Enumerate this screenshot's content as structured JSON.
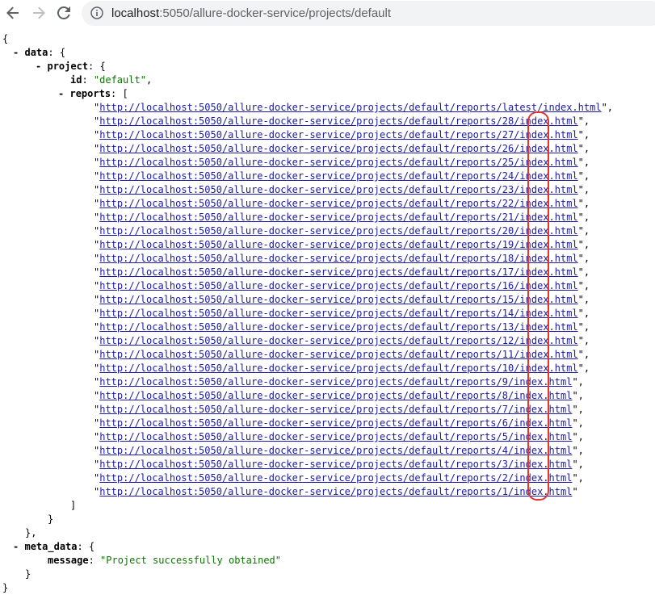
{
  "browser": {
    "url_host": "localhost",
    "url_rest": ":5050/allure-docker-service/projects/default",
    "icons": {
      "back": "arrow-left-icon",
      "forward": "arrow-right-icon",
      "reload": "reload-icon",
      "info": "info-icon"
    }
  },
  "json_view": {
    "open_brace": "{",
    "close_brace": "}",
    "collapse_symbol": "-",
    "data_key": "data",
    "project_key": "project",
    "id_key": "id",
    "id_value": "\"default\"",
    "reports_key": "reports",
    "open_bracket": "[",
    "close_bracket": "]",
    "meta_key": "meta_data",
    "message_key": "message",
    "message_value": "\"Project successfully obtained\"",
    "reports": [
      "http://localhost:5050/allure-docker-service/projects/default/reports/latest/index.html",
      "http://localhost:5050/allure-docker-service/projects/default/reports/28/index.html",
      "http://localhost:5050/allure-docker-service/projects/default/reports/27/index.html",
      "http://localhost:5050/allure-docker-service/projects/default/reports/26/index.html",
      "http://localhost:5050/allure-docker-service/projects/default/reports/25/index.html",
      "http://localhost:5050/allure-docker-service/projects/default/reports/24/index.html",
      "http://localhost:5050/allure-docker-service/projects/default/reports/23/index.html",
      "http://localhost:5050/allure-docker-service/projects/default/reports/22/index.html",
      "http://localhost:5050/allure-docker-service/projects/default/reports/21/index.html",
      "http://localhost:5050/allure-docker-service/projects/default/reports/20/index.html",
      "http://localhost:5050/allure-docker-service/projects/default/reports/19/index.html",
      "http://localhost:5050/allure-docker-service/projects/default/reports/18/index.html",
      "http://localhost:5050/allure-docker-service/projects/default/reports/17/index.html",
      "http://localhost:5050/allure-docker-service/projects/default/reports/16/index.html",
      "http://localhost:5050/allure-docker-service/projects/default/reports/15/index.html",
      "http://localhost:5050/allure-docker-service/projects/default/reports/14/index.html",
      "http://localhost:5050/allure-docker-service/projects/default/reports/13/index.html",
      "http://localhost:5050/allure-docker-service/projects/default/reports/12/index.html",
      "http://localhost:5050/allure-docker-service/projects/default/reports/11/index.html",
      "http://localhost:5050/allure-docker-service/projects/default/reports/10/index.html",
      "http://localhost:5050/allure-docker-service/projects/default/reports/9/index.html",
      "http://localhost:5050/allure-docker-service/projects/default/reports/8/index.html",
      "http://localhost:5050/allure-docker-service/projects/default/reports/7/index.html",
      "http://localhost:5050/allure-docker-service/projects/default/reports/6/index.html",
      "http://localhost:5050/allure-docker-service/projects/default/reports/5/index.html",
      "http://localhost:5050/allure-docker-service/projects/default/reports/4/index.html",
      "http://localhost:5050/allure-docker-service/projects/default/reports/3/index.html",
      "http://localhost:5050/allure-docker-service/projects/default/reports/2/index.html",
      "http://localhost:5050/allure-docker-service/projects/default/reports/1/index.html"
    ]
  },
  "annotation": {
    "shape": "rounded-rectangle",
    "color": "#e2382a"
  }
}
